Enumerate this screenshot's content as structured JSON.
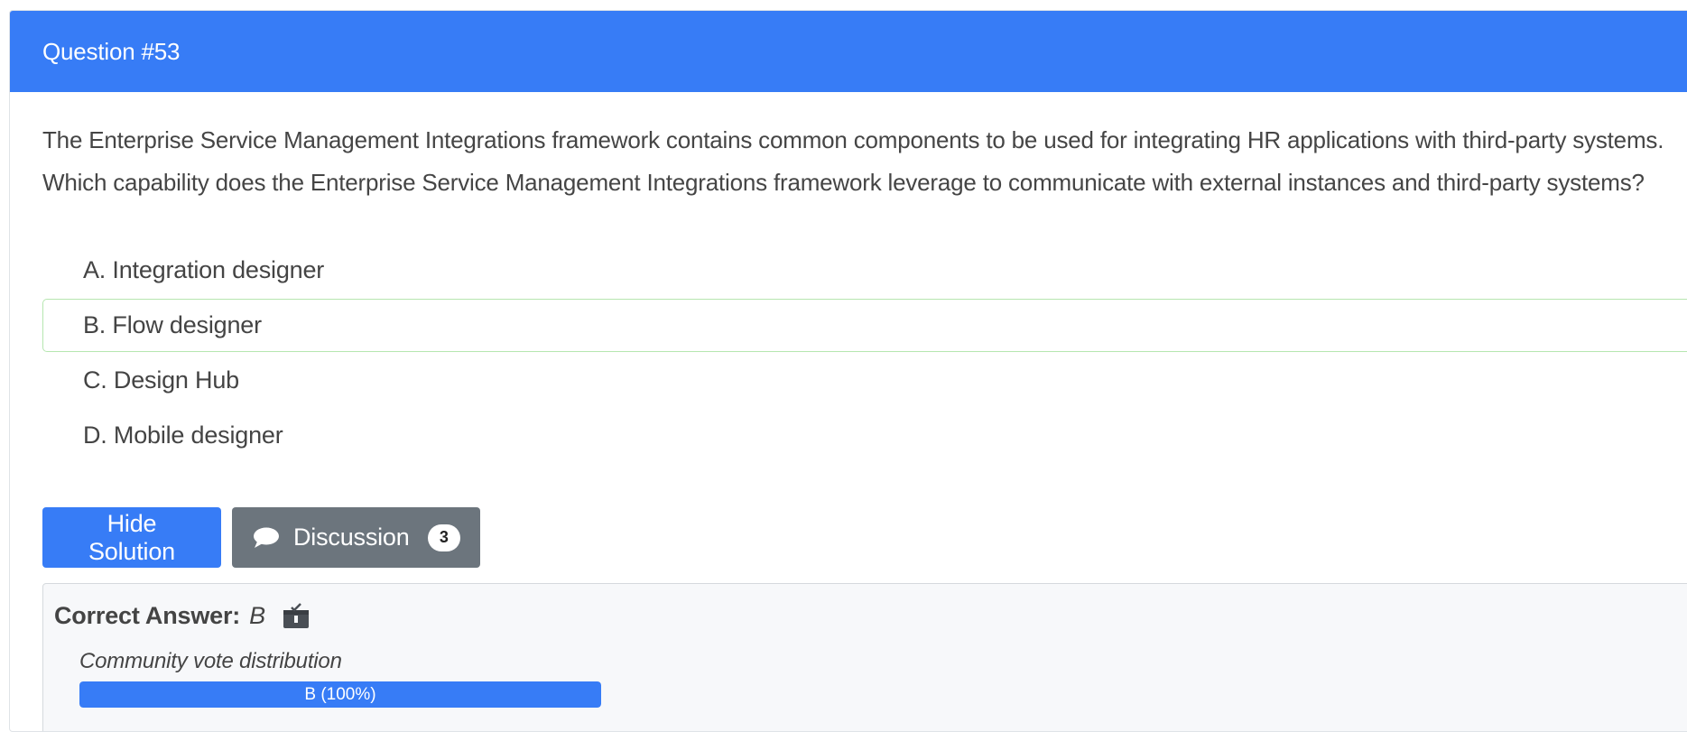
{
  "header": {
    "title": "Question #53"
  },
  "question": {
    "line1": "The Enterprise Service Management Integrations framework contains common components to be used for integrating HR applications with third-party systems.",
    "line2": "Which capability does the Enterprise Service Management Integrations framework leverage to communicate with external instances and third-party systems?"
  },
  "choices": [
    {
      "text": "A. Integration designer"
    },
    {
      "text": "B. Flow designer"
    },
    {
      "text": "C. Design Hub"
    },
    {
      "text": "D. Mobile designer"
    }
  ],
  "actions": {
    "hide_solution_label": "Hide Solution",
    "discussion_label": "Discussion",
    "discussion_count": "3"
  },
  "answer": {
    "label": "Correct Answer:",
    "value": "B",
    "vote_title": "Community vote distribution",
    "votes": [
      {
        "label": "B (100%)",
        "fraction": 1.0
      }
    ]
  },
  "colors": {
    "accent": "#377cf6",
    "secondary": "#6c757d",
    "correct_border": "#b6e6b0"
  },
  "icons": {
    "discussion": "speech-bubble-icon",
    "reveal": "reveal-solution-icon"
  }
}
